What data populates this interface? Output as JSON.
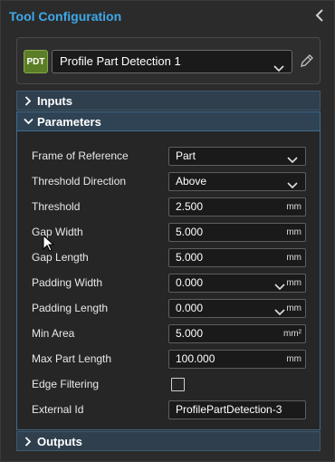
{
  "header": {
    "title": "Tool Configuration",
    "collapse_icon": "chevron-left-icon"
  },
  "tool": {
    "badge": "PDT",
    "name": "Profile Part Detection 1",
    "badge_color": "#5c7d27"
  },
  "sections": {
    "inputs": "Inputs",
    "parameters": "Parameters",
    "outputs": "Outputs"
  },
  "params": {
    "frame_of_reference": {
      "label": "Frame of Reference",
      "value": "Part"
    },
    "threshold_direction": {
      "label": "Threshold Direction",
      "value": "Above"
    },
    "threshold": {
      "label": "Threshold",
      "value": "2.500",
      "unit": "mm"
    },
    "gap_width": {
      "label": "Gap Width",
      "value": "5.000",
      "unit": "mm"
    },
    "gap_length": {
      "label": "Gap Length",
      "value": "5.000",
      "unit": "mm"
    },
    "padding_width": {
      "label": "Padding Width",
      "value": "0.000",
      "unit": "mm"
    },
    "padding_length": {
      "label": "Padding Length",
      "value": "0.000",
      "unit": "mm"
    },
    "min_area": {
      "label": "Min Area",
      "value": "5.000",
      "unit": "mm²"
    },
    "max_part_length": {
      "label": "Max Part Length",
      "value": "100.000",
      "unit": "mm"
    },
    "edge_filtering": {
      "label": "Edge Filtering",
      "checked": false
    },
    "external_id": {
      "label": "External Id",
      "value": "ProfilePartDetection-3"
    }
  },
  "colors": {
    "accent": "#3fa9e8",
    "section_bar": "#2f3f4d"
  }
}
